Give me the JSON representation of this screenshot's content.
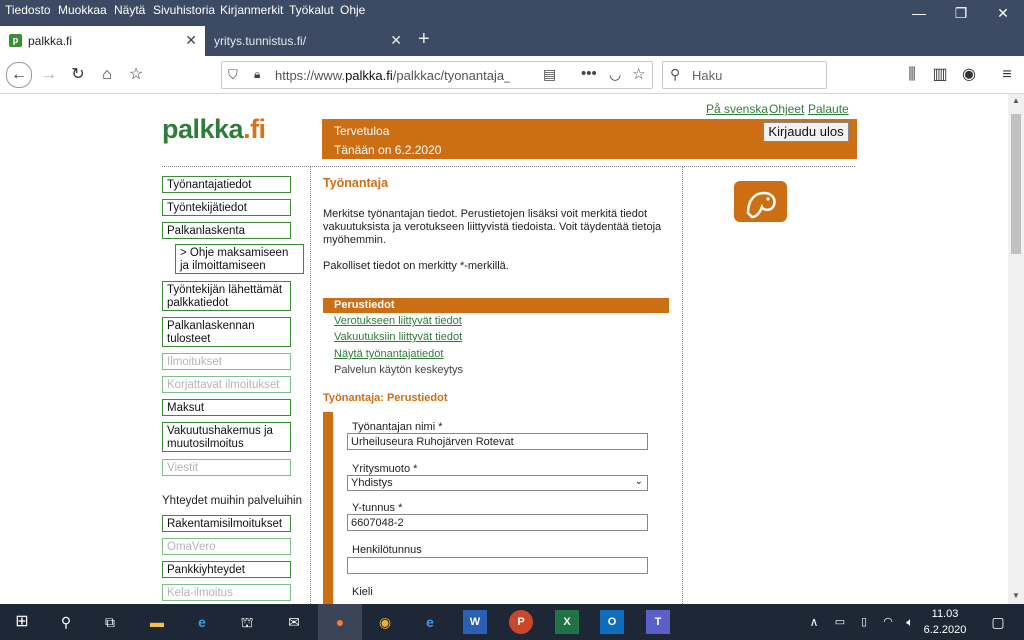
{
  "menubar": {
    "items": [
      "Tiedosto",
      "Muokkaa",
      "Näytä",
      "Sivuhistoria",
      "Kirjanmerkit",
      "Työkalut",
      "Ohje"
    ]
  },
  "tabs": [
    {
      "title": "palkka.fi",
      "active": true,
      "favicon": "p"
    },
    {
      "title": "yritys.tunnistus.fi/",
      "active": false
    }
  ],
  "nav": {
    "url_prefix": "https://www.",
    "url_domain": "palkka.fi",
    "url_path": "/palkkac/tyonantaja_",
    "search_placeholder": "Haku"
  },
  "page": {
    "top_links": [
      "På svenska",
      "Ohjeet",
      "Palaute"
    ],
    "logo_main": "palkka",
    "logo_suffix": ".fi",
    "banner_welcome": "Tervetuloa",
    "banner_date": "Tänään on 6.2.2020",
    "logout": "Kirjaudu ulos",
    "sidebar": [
      {
        "label": "Työnantajatiedot",
        "enabled": true
      },
      {
        "label": "Työntekijätiedot",
        "enabled": true
      },
      {
        "label": "Palkanlaskenta",
        "enabled": true
      },
      {
        "label": "> Ohje maksamiseen ja ilmoittamiseen",
        "enabled": true
      },
      {
        "label": "Työntekijän lähettämät palkkatiedot",
        "enabled": true
      },
      {
        "label": "Palkanlaskennan tulosteet",
        "enabled": true
      },
      {
        "label": "Ilmoitukset",
        "enabled": false
      },
      {
        "label": "Korjattavat ilmoitukset",
        "enabled": false
      },
      {
        "label": "Maksut",
        "enabled": true
      },
      {
        "label": "Vakuutushakemus ja muutosilmoitus",
        "enabled": true
      },
      {
        "label": "Viestit",
        "enabled": false
      }
    ],
    "sidebar_heading": "Yhteydet muihin palveluihin",
    "sidebar2": [
      {
        "label": "Rakentamisilmoitukset",
        "enabled": true
      },
      {
        "label": "OmaVero",
        "enabled": false
      },
      {
        "label": "Pankkiyhteydet",
        "enabled": true
      },
      {
        "label": "Kela-ilmoitus",
        "enabled": false
      }
    ],
    "main_title": "Työnantaja",
    "intro": "Merkitse työnantajan tiedot. Perustietojen lisäksi voit merkitä tiedot vakuutuksista ja verotukseen liittyvistä tiedoista. Voit täydentää tietoja myöhemmin.",
    "required_note": "Pakolliset tiedot on merkitty *-merkillä.",
    "section_active": "Perustiedot",
    "section_links": [
      "Verotukseen liittyvät tiedot",
      "Vakuutuksiin liittyvät tiedot",
      "Näytä työnantajatiedot"
    ],
    "section_plain": "Palvelun käytön keskeytys",
    "form_title": "Työnantaja: Perustiedot",
    "form": {
      "name_label": "Työnantajan nimi *",
      "name_value": "Urheiluseura Ruhojärven Rotevat",
      "type_label": "Yritysmuoto *",
      "type_value": "Yhdistys",
      "ytunnus_label": "Y-tunnus *",
      "ytunnus_value": "6607048-2",
      "hetu_label": "Henkilötunnus",
      "hetu_value": "",
      "kieli_label": "Kieli"
    }
  },
  "taskbar": {
    "time": "11.03",
    "date": "6.2.2020"
  },
  "colors": {
    "accent_orange": "#cc6f14",
    "brand_green": "#2f7d3a",
    "chrome_dark": "#3c4b63"
  }
}
